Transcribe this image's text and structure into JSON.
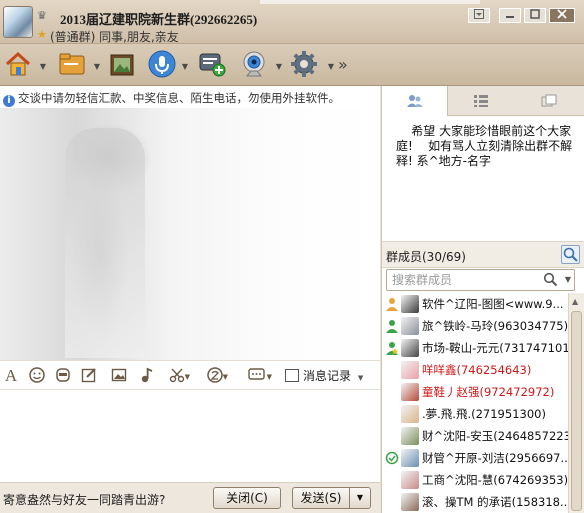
{
  "window": {
    "group_name": "2013届辽建职院新生群(292662265)",
    "group_subtitle": "(普通群) 同事,朋友,亲友"
  },
  "toolbar": {
    "items": [
      "home-icon",
      "file-transfer-icon",
      "album-icon",
      "voice-icon",
      "add-note-icon",
      "webcam-icon",
      "settings-icon"
    ],
    "more": "»"
  },
  "chat": {
    "notice": "交谈中请勿轻信汇款、中奖信息、陌生电话，勿使用外挂软件。"
  },
  "format_bar": {
    "history_label": "消息记录"
  },
  "bottom": {
    "ad_text": "寄意盎然与好友一同踏青出游?",
    "close_label": "关闭(C)",
    "send_label": "发送(S)"
  },
  "announcement": {
    "text": "    希望 大家能珍惜眼前这个大家庭!    如有骂人立刻清除出群不解释! 系^地方-名字"
  },
  "members": {
    "header": "群成员(30/69)",
    "search_placeholder": "搜索群成员",
    "list": [
      {
        "name": "软件^辽阳-图图<www.9...",
        "role": "owner",
        "red": false,
        "avatar_color": "#3a3a3a"
      },
      {
        "name": "旅^铁岭-马玲(963034775)",
        "role": "admin",
        "red": false,
        "avatar_color": "#8a8f99"
      },
      {
        "name": "市场-鞍山-元元(731747101)",
        "role": "admin-star",
        "red": false,
        "avatar_color": "#444"
      },
      {
        "name": "咩咩鑫(746254643)",
        "role": "",
        "red": true,
        "avatar_color": "#e8a0a8"
      },
      {
        "name": "童鞋丿赵强(972472972)",
        "role": "",
        "red": true,
        "avatar_color": "#b54a3a"
      },
      {
        "name": ".夢.飛.飛.(271951300)",
        "role": "",
        "red": false,
        "avatar_color": "#d9b48a"
      },
      {
        "name": "财^沈阳-安玉(2464857223)",
        "role": "",
        "red": false,
        "avatar_color": "#7a8f5a"
      },
      {
        "name": "财管^开原-刘洁(2956697...",
        "role": "mobile",
        "red": false,
        "avatar_color": "#6a8fb0"
      },
      {
        "name": "工商^沈阳-慧(674269353)",
        "role": "",
        "red": false,
        "avatar_color": "#c98a8a"
      },
      {
        "name": "滚、操TM 的承诺(158318...",
        "role": "",
        "red": false,
        "avatar_color": "#8a6a5a"
      }
    ]
  }
}
